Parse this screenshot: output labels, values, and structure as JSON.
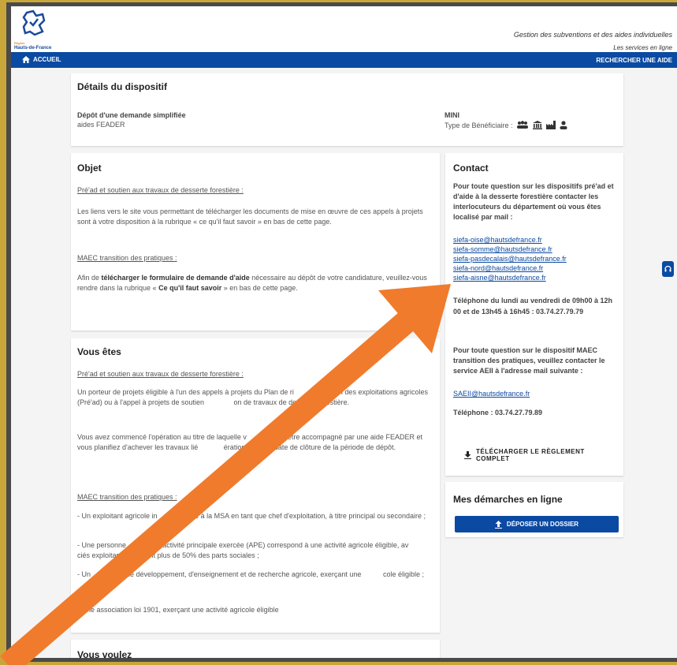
{
  "header": {
    "logo_region": "Région",
    "logo_name": "Hauts-de-France",
    "tagline": "Gestion des subventions et des aides individuelles",
    "subtagline": "Les services en ligne"
  },
  "nav": {
    "home": "ACCUEIL",
    "search": "RECHERCHER UNE AIDE"
  },
  "details": {
    "title": "Détails du dispositif",
    "left_label": "Dépôt d'une demande simplifiée",
    "left_value": "aides FEADER",
    "right_label": "MINI",
    "benef_label": "Type de Bénéficiaire :"
  },
  "objet": {
    "title": "Objet",
    "sub1": "Pré'ad et soutien aux travaux de desserte forestière :",
    "p1": "Les liens vers le site vous permettant de télécharger les documents de mise en œuvre de ces appels à projets sont à votre disposition à la rubrique « ce qu'il faut savoir » en bas de cette page.",
    "sub2": "MAEC transition des pratiques :",
    "p2a": "Afin de ",
    "p2b": "télécharger le formulaire de demande d'aide",
    "p2c": " nécessaire au dépôt de votre candidature, veuillez-vous rendre dans la rubrique « ",
    "p2d": "Ce qu'il faut savoir",
    "p2e": " » en bas de cette page."
  },
  "vous_etes": {
    "title": "Vous êtes",
    "sub1": "Pré'ad et soutien aux travaux de desserte forestière :",
    "p1": "Un porteur de projets éligible à l'un des appels à projets du Plan de ri        adaptation des exploitations agricoles (Pré'ad) ou à l'appel à projets de soutien               on de travaux de desserte forestière.",
    "p2": "Vous avez commencé l'opération au titre de laquelle v                ez être accompagné par une aide FEADER et vous planifiez d'achever les travaux lié             ération avant la date de clôture de la période de dépôt.",
    "sub2": "MAEC transition des pratiques :",
    "b1": "- Un exploitant agricole in                   é à la MSA en tant que chef d'exploitation, à titre principal ou secondaire ;",
    "b2": "- Une personne               t l'activité principale exercée (APE) correspond à une activité agricole éligible, av              ciés exploitants détenant plus de 50% des parts sociales ;",
    "b3": "- Un            ent de développement, d'enseignement et de recherche agricole, exerçant une           cole éligible ;",
    "b4": "- Une association loi 1901, exerçant une activité agricole éligible"
  },
  "vous_voulez": {
    "title": "Vous voulez"
  },
  "contact": {
    "title": "Contact",
    "intro": "Pour toute question sur les dispositifs pré'ad et d'aide à la desserte forestière contacter les interlocuteurs du département où vous êtes localisé par mail :",
    "emails": [
      "siefa-oise@hautsdefrance.fr",
      "siefa-somme@hautsdefrance.fr",
      "siefa-pasdecalais@hautsdefrance.fr",
      "siefa-nord@hautsdefrance.fr",
      "siefa-aisne@hautsdefrance.fr"
    ],
    "phone1": "Téléphone du lundi au vendredi de 09h00 à 12h 00 et de 13h45 à 16h45 : 03.74.27.79.79",
    "intro2": "Pour toute question sur le dispositif MAEC transition des pratiques, veuillez contacter le service AEII à l'adresse mail suivante :",
    "email2": "SAEII@hautsdefrance.fr",
    "phone2": "Téléphone : 03.74.27.79.89",
    "download_line1": "TÉLÉCHARGER LE RÈGLEMENT",
    "download_line2": "COMPLET"
  },
  "demarches": {
    "title": "Mes démarches en ligne",
    "button": "DÉPOSER UN DOSSIER"
  },
  "colors": {
    "primary": "#0b4aa2",
    "arrow": "#f07b2c",
    "background_border": "#c9a63a"
  }
}
